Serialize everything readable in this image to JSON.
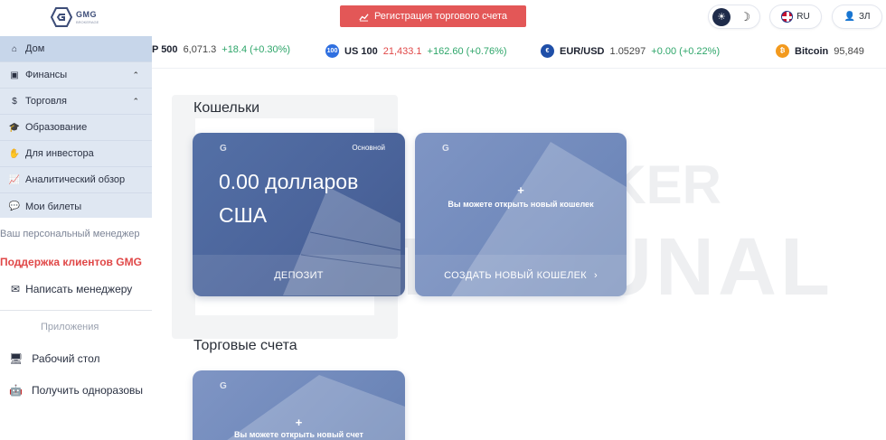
{
  "header": {
    "logo_text": "GMG",
    "logo_sub": "BROKERAGE",
    "register_label": "Регистрация торгового счета",
    "lang_label": "RU",
    "user_label": "ЗЛ"
  },
  "ticker": [
    {
      "name": "P 500",
      "price": "6,071.3",
      "change": "+18.4 (+0.30%)",
      "price_color": "normal"
    },
    {
      "name": "US 100",
      "price": "21,433.1",
      "change": "+162.60 (+0.76%)",
      "price_color": "red",
      "icon": "100"
    },
    {
      "name": "EUR/USD",
      "price": "1.05297",
      "change": "+0.00 (+0.22%)",
      "price_color": "normal"
    },
    {
      "name": "Bitcoin",
      "price": "95,849",
      "change": "",
      "price_color": "normal",
      "icon": "₿"
    }
  ],
  "sidebar": {
    "items": [
      {
        "label": "Дом",
        "icon": "home-icon"
      },
      {
        "label": "Финансы",
        "icon": "wallet-icon"
      },
      {
        "label": "Торговля",
        "icon": "dollar-icon"
      },
      {
        "label": "Образование",
        "icon": "graduation-cap-icon"
      },
      {
        "label": "Для инвестора",
        "icon": "handshake-icon"
      },
      {
        "label": "Аналитический обзор",
        "icon": "chart-icon"
      },
      {
        "label": "Мои билеты",
        "icon": "chat-bubble-icon"
      }
    ],
    "manager_label": "Ваш персональный менеджер",
    "support_label": "Поддержка клиентов GMG",
    "write_manager": "Написать менеджеру",
    "apps_label": "Приложения",
    "desktop_label": "Рабочий стол",
    "otp_label": "Получить одноразовы"
  },
  "wallets": {
    "title": "Кошельки",
    "main_badge": "Основной",
    "amount": "0.00 долларов США",
    "deposit_label": "ДЕПОЗИТ",
    "new_wallet_text": "Вы можете открыть новый кошелек",
    "create_label": "СОЗДАТЬ НОВЫЙ КОШЕЛЕК",
    "plus": "+"
  },
  "accounts": {
    "title": "Торговые счета",
    "new_account_text": "Вы можете открыть новый счет",
    "plus": "+"
  },
  "watermark": {
    "line1": "BROKER",
    "line2": "TRIBUNAL"
  },
  "colors": {
    "accent_red": "#e35757",
    "sidebar_bg": "#dfe7f2",
    "card_primary": "#4a639a",
    "card_alt": "#7089bb",
    "positive": "#2ea66a"
  }
}
